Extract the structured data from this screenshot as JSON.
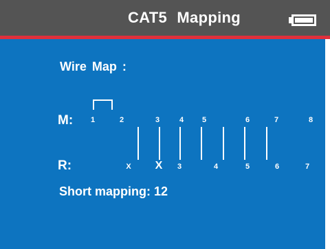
{
  "header": {
    "title": "CAT5 Mapping",
    "battery_icon": "battery-full-icon"
  },
  "wiremap": {
    "section_label": "Wire Map :",
    "main_label": "M:",
    "remote_label": "R:",
    "main_pins": [
      "1",
      "2",
      "3",
      "4",
      "5",
      "6",
      "7",
      "8"
    ],
    "short_pair": [
      "1",
      "2"
    ],
    "remote_pins": [
      "X",
      "X",
      "3",
      "4",
      "5",
      "6",
      "7"
    ],
    "connected_wires": [
      "3",
      "4",
      "5",
      "6",
      "7",
      "8"
    ]
  },
  "status": {
    "text": "Short mapping: 12"
  },
  "colors": {
    "header_bg": "#545454",
    "accent_line": "#e0303c",
    "panel_bg": "#0d74c0",
    "text": "#ffffff"
  }
}
